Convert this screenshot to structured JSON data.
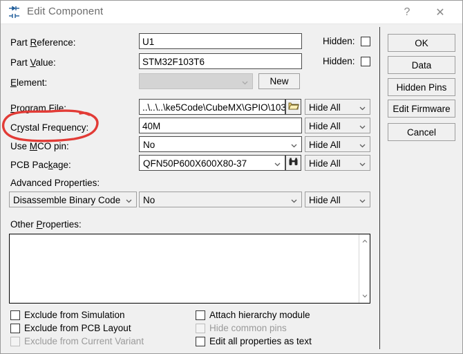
{
  "window": {
    "title": "Edit Component",
    "icon": "component-ic-icon",
    "help_label": "?",
    "close_label": "✕"
  },
  "fields": {
    "part_reference": {
      "label_pre": "Part ",
      "label_key": "R",
      "label_post": "eference:",
      "value": "U1",
      "hidden_label": "Hidden:",
      "hidden_checked": false
    },
    "part_value": {
      "label_pre": "Part ",
      "label_key": "V",
      "label_post": "alue:",
      "value": "STM32F103T6",
      "hidden_label": "Hidden:",
      "hidden_checked": false
    },
    "element": {
      "label_pre": "",
      "label_key": "E",
      "label_post": "lement:",
      "value": "",
      "disabled": true,
      "new_button": "New"
    },
    "program_file": {
      "label_pre": "",
      "label_key": "P",
      "label_post": "rogram File:",
      "value": "..\\..\\..\\ke5Code\\CubeMX\\GPIO\\103",
      "browse_icon": "folder-open-icon",
      "visibility": "Hide All"
    },
    "crystal_frequency": {
      "label_pre": "C",
      "label_key": "r",
      "label_post": "ystal Frequency:",
      "value": "40M",
      "visibility": "Hide All",
      "annotated": true
    },
    "use_mco_pin": {
      "label_pre": "Use ",
      "label_key": "M",
      "label_post": "CO pin:",
      "value": "No",
      "visibility": "Hide All"
    },
    "pcb_package": {
      "label_pre": "PCB Pac",
      "label_key": "k",
      "label_post": "age:",
      "value": "QFN50P600X600X80-37",
      "search_icon": "binoculars-icon",
      "visibility": "Hide All"
    },
    "advanced_properties": {
      "label_pre": "Advanced Properties:",
      "label_key": "",
      "label_post": "",
      "name": "Disassemble Binary Code",
      "value": "No",
      "visibility": "Hide All"
    },
    "other_properties": {
      "label_pre": "Other ",
      "label_key": "P",
      "label_post": "roperties:",
      "value": ""
    }
  },
  "buttons": [
    {
      "id": "ok",
      "label": "OK"
    },
    {
      "id": "data",
      "label": "Data"
    },
    {
      "id": "hidden-pins",
      "label": "Hidden Pins"
    },
    {
      "id": "edit-firmware",
      "label": "Edit Firmware"
    },
    {
      "id": "cancel",
      "label": "Cancel"
    }
  ],
  "checkboxes_left": [
    {
      "id": "exclude-simulation",
      "label": "Exclude from Simulation",
      "checked": false,
      "disabled": false
    },
    {
      "id": "exclude-pcb-layout",
      "label": "Exclude from PCB Layout",
      "checked": false,
      "disabled": false
    },
    {
      "id": "exclude-current-variant",
      "label": "Exclude from Current Variant",
      "checked": false,
      "disabled": true
    }
  ],
  "checkboxes_right": [
    {
      "id": "attach-hierarchy-module",
      "label": "Attach hierarchy module",
      "checked": false,
      "disabled": false
    },
    {
      "id": "hide-common-pins",
      "label": "Hide common pins",
      "checked": false,
      "disabled": true
    },
    {
      "id": "edit-all-properties-text",
      "label": "Edit all properties as text",
      "checked": false,
      "disabled": false
    }
  ],
  "annotation": {
    "shape": "hand-drawn-ellipse",
    "color": "#e23b36",
    "target": "crystal-frequency-label"
  },
  "colors": {
    "dialog_background": "#f0f0f0",
    "field_background": "#ffffff",
    "annotation_red": "#e23b36",
    "title_text": "#6b6b6b"
  }
}
